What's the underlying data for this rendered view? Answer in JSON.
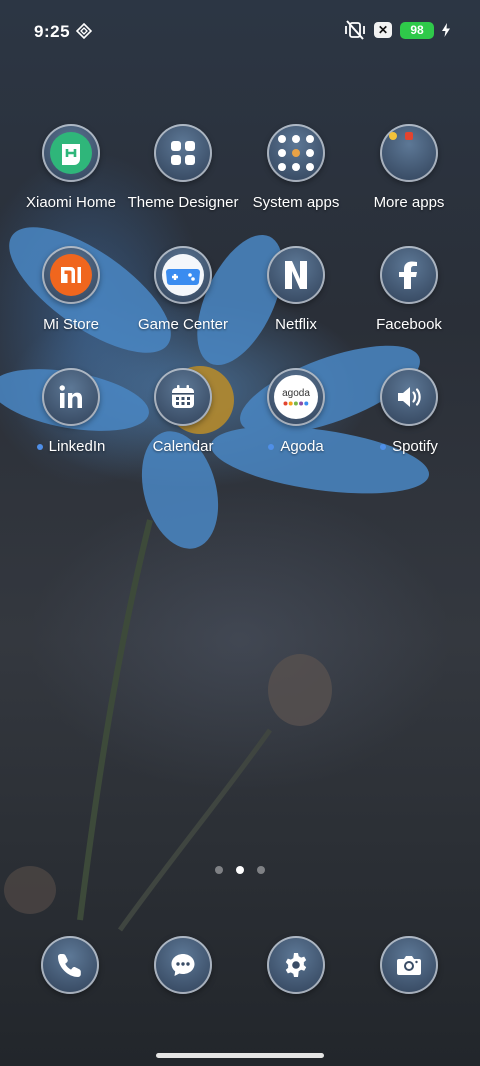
{
  "status_bar": {
    "time": "9:25",
    "battery": "98"
  },
  "apps": [
    {
      "label": "Xiaomi Home",
      "icon": "xiaomi-home-icon",
      "notification": false
    },
    {
      "label": "Theme Designer",
      "icon": "theme-designer-icon",
      "notification": false
    },
    {
      "label": "System apps",
      "icon": "system-apps-folder-icon",
      "notification": false
    },
    {
      "label": "More apps",
      "icon": "more-apps-folder-icon",
      "notification": false
    },
    {
      "label": "Mi Store",
      "icon": "mi-store-icon",
      "notification": false
    },
    {
      "label": "Game Center",
      "icon": "game-center-icon",
      "notification": false
    },
    {
      "label": "Netflix",
      "icon": "netflix-icon",
      "notification": false
    },
    {
      "label": "Facebook",
      "icon": "facebook-icon",
      "notification": false
    },
    {
      "label": "LinkedIn",
      "icon": "linkedin-icon",
      "notification": true
    },
    {
      "label": "Calendar",
      "icon": "calendar-icon",
      "notification": false
    },
    {
      "label": "Agoda",
      "icon": "agoda-icon",
      "notification": true
    },
    {
      "label": "Spotify",
      "icon": "spotify-icon",
      "notification": true
    }
  ],
  "agoda_logo_text": "agoda",
  "dock": [
    {
      "icon": "phone-icon"
    },
    {
      "icon": "messages-icon"
    },
    {
      "icon": "settings-icon"
    },
    {
      "icon": "camera-icon"
    }
  ],
  "page_indicator": {
    "pages": 3,
    "current": 2
  },
  "colors": {
    "accent_dot": "#4f8fe8",
    "battery": "#2fc94a",
    "icon_bg": "#3a4d66"
  }
}
